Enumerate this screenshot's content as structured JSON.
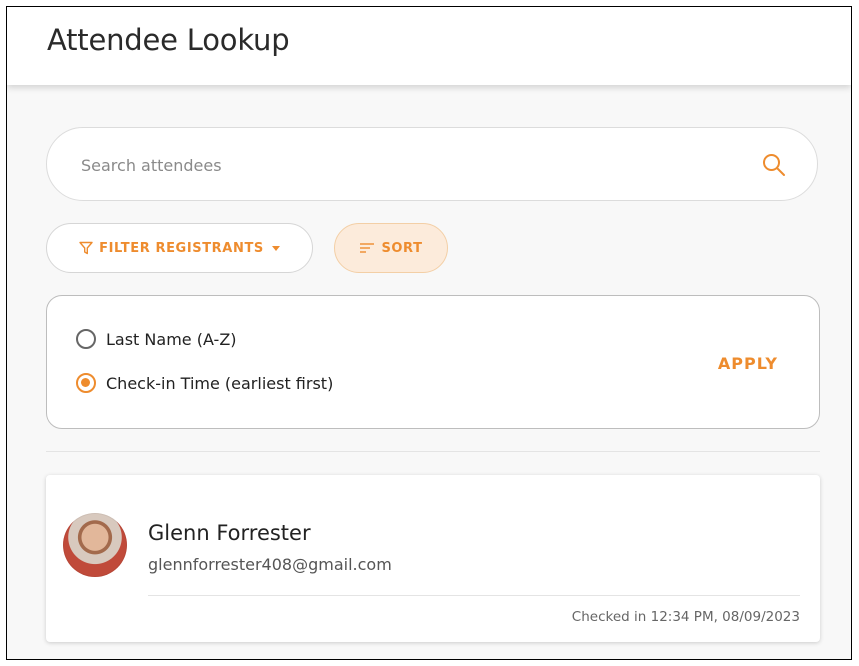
{
  "header": {
    "title": "Attendee Lookup"
  },
  "search": {
    "placeholder": "Search attendees",
    "value": "",
    "icon": "search-icon"
  },
  "filters": {
    "filter_label": "FILTER REGISTRANTS",
    "filter_icon": "funnel-icon",
    "sort_label": "SORT",
    "sort_icon": "sort-lines-icon",
    "sort_active": true
  },
  "sort_panel": {
    "options": [
      {
        "label": "Last Name (A-Z)",
        "selected": false
      },
      {
        "label": "Check-in Time (earliest first)",
        "selected": true
      }
    ],
    "apply_label": "APPLY"
  },
  "attendees": [
    {
      "name": "Glenn Forrester",
      "email": "glennforrester408@gmail.com",
      "checked_in": "Checked in 12:34 PM, 08/09/2023"
    }
  ],
  "colors": {
    "accent": "#ee8c2e",
    "accent_bg": "#fcebdb",
    "background": "#f8f8f8"
  }
}
